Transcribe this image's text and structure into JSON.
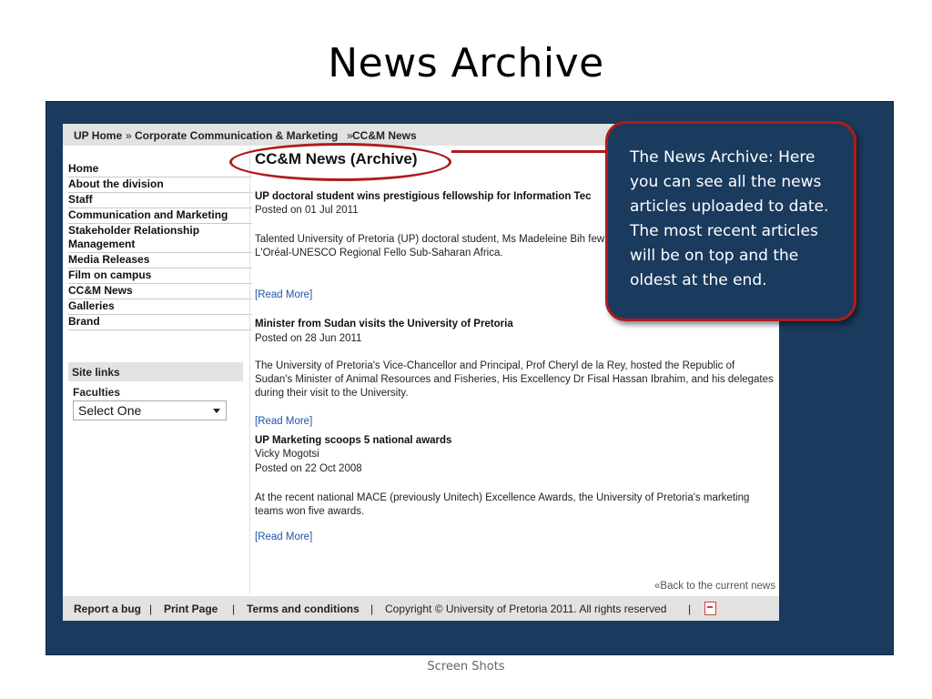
{
  "slide": {
    "title": "News Archive",
    "caption": "Screen Shots"
  },
  "breadcrumb": {
    "home": "UP Home",
    "sep1": "»",
    "section": "Corporate Communication & Marketing",
    "sep2": "»",
    "current": "CC&M News"
  },
  "sidebar": {
    "items": [
      {
        "label": "Home"
      },
      {
        "label": "About the division"
      },
      {
        "label": "Staff"
      },
      {
        "label": "Communication and Marketing"
      },
      {
        "label": "Stakeholder Relationship Management"
      },
      {
        "label": "Media Releases"
      },
      {
        "label": "Film on campus"
      },
      {
        "label": "CC&M News"
      },
      {
        "label": "Galleries"
      },
      {
        "label": "Brand"
      }
    ],
    "site_links_label": "Site links",
    "faculties_label": "Faculties",
    "faculties_select": "Select One"
  },
  "main": {
    "heading": "CC&M News (Archive)",
    "articles": [
      {
        "title": "UP doctoral student wins prestigious fellowship for Information Tec",
        "posted": "Posted on 01 Jul 2011",
        "body": "Talented University of Pretoria (UP) doctoral student, Ms Madeleine Bih few who received a prestigious 2011 L'Oréal-UNESCO Regional Fello Sub-Saharan Africa.",
        "read_more": "[Read More]"
      },
      {
        "title": "Minister from Sudan visits the University of Pretoria",
        "posted": "Posted on 28 Jun 2011",
        "body": "The University of Pretoria's Vice-Chancellor and Principal, Prof Cheryl de la Rey, hosted the Republic of Sudan's Minister of Animal Resources and Fisheries, His Excellency Dr Fisal Hassan Ibrahim, and his delegates during their visit to the University.",
        "read_more": "[Read More]"
      },
      {
        "title": "UP Marketing scoops 5 national awards",
        "author": "Vicky Mogotsi",
        "posted": "Posted on 22 Oct 2008",
        "body": "At the recent national MACE (previously Unitech) Excellence Awards, the University of Pretoria's marketing teams won five awards.",
        "read_more": "[Read More]"
      }
    ],
    "back_link": "«Back to the current news"
  },
  "footer": {
    "report_bug": "Report a bug",
    "print_page": "Print Page",
    "terms": "Terms and conditions",
    "separator": "|",
    "copyright": "Copyright © University of Pretoria 2011. All rights reserved",
    "pdf_icon": "pdf-icon"
  },
  "callout": {
    "text": "The News Archive: Here you can see all the news articles uploaded to date. The most recent articles will be on top and the oldest at the end."
  },
  "colors": {
    "frame_bg": "#1a3a5e",
    "highlight_red": "#b01b1b",
    "link_blue": "#1f55a8"
  }
}
